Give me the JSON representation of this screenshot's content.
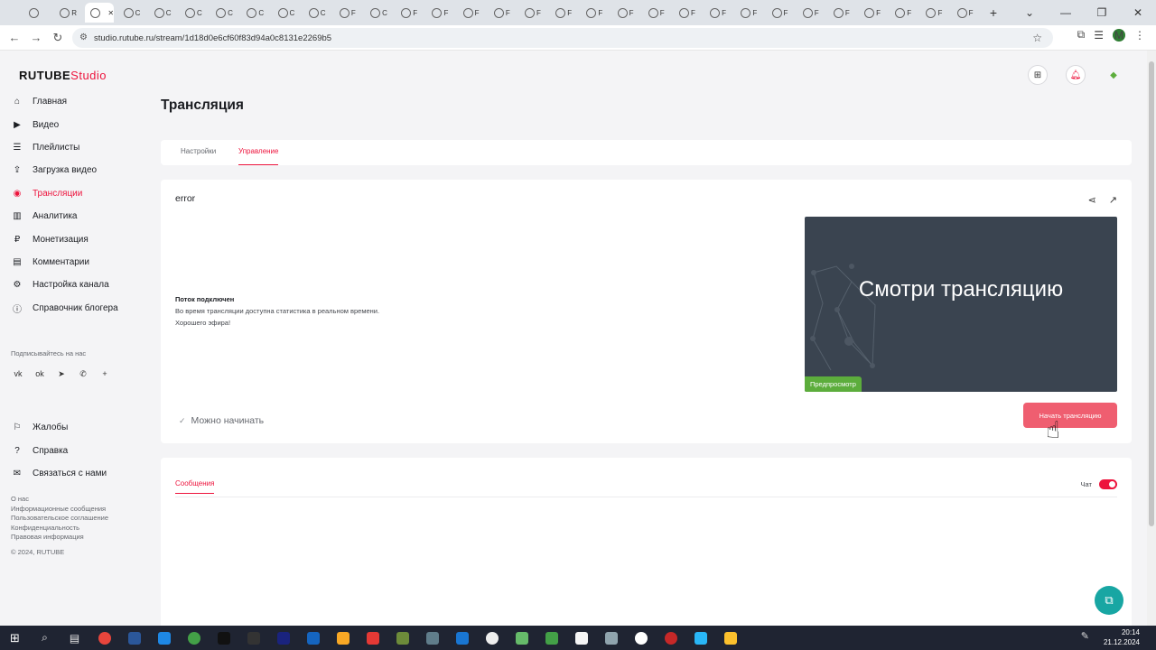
{
  "browser": {
    "url": "studio.rutube.ru/stream/1d18d0e6cf60f83d94a0c8131e2269b5",
    "tabs": [
      {
        "label": "",
        "icon": "chrome-icon"
      },
      {
        "label": "R",
        "icon": "rutube-icon"
      },
      {
        "label": "",
        "icon": "rutube-studio-icon",
        "active": true
      },
      {
        "label": "C",
        "icon": "openai-icon"
      },
      {
        "label": "C",
        "icon": "openai-icon"
      },
      {
        "label": "C",
        "icon": "web-icon"
      },
      {
        "label": "C",
        "icon": "web-icon"
      },
      {
        "label": "C",
        "icon": "web-icon"
      },
      {
        "label": "C",
        "icon": "web-icon"
      },
      {
        "label": "C",
        "icon": "web-icon"
      },
      {
        "label": "F",
        "icon": "web-icon"
      },
      {
        "label": "C",
        "icon": "web-icon"
      },
      {
        "label": "F",
        "icon": "web-icon"
      },
      {
        "label": "F",
        "icon": "web-icon"
      },
      {
        "label": "F",
        "icon": "web-icon"
      },
      {
        "label": "F",
        "icon": "web-icon"
      },
      {
        "label": "F",
        "icon": "web-icon"
      },
      {
        "label": "F",
        "icon": "web-icon"
      },
      {
        "label": "F",
        "icon": "web-icon"
      },
      {
        "label": "F",
        "icon": "web-icon"
      },
      {
        "label": "F",
        "icon": "web-icon"
      },
      {
        "label": "F",
        "icon": "web-icon"
      },
      {
        "label": "F",
        "icon": "web-icon"
      },
      {
        "label": "F",
        "icon": "web-icon"
      },
      {
        "label": "F",
        "icon": "web-icon"
      },
      {
        "label": "F",
        "icon": "web-icon"
      },
      {
        "label": "F",
        "icon": "web-icon"
      },
      {
        "label": "F",
        "icon": "web-icon"
      },
      {
        "label": "F",
        "icon": "web-icon"
      },
      {
        "label": "F",
        "icon": "web-icon"
      },
      {
        "label": "F",
        "icon": "web-icon"
      }
    ],
    "profile_initial": "M"
  },
  "app": {
    "logo_main": "RUTUBE",
    "logo_sub": "Studio",
    "accent": "#ed143d"
  },
  "sidebar": {
    "items": [
      {
        "label": "Главная",
        "icon": "home-icon"
      },
      {
        "label": "Видео",
        "icon": "video-icon"
      },
      {
        "label": "Плейлисты",
        "icon": "playlist-icon"
      },
      {
        "label": "Загрузка видео",
        "icon": "upload-icon"
      },
      {
        "label": "Трансляции",
        "icon": "broadcast-icon",
        "active": true
      },
      {
        "label": "Аналитика",
        "icon": "analytics-icon"
      },
      {
        "label": "Монетизация",
        "icon": "monetization-icon"
      },
      {
        "label": "Комментарии",
        "icon": "comments-icon"
      },
      {
        "label": "Настройка канала",
        "icon": "settings-icon"
      },
      {
        "label": "Справочник блогера",
        "icon": "info-icon"
      }
    ],
    "follow_label": "Подписывайтесь на нас",
    "socials": [
      "vk-icon",
      "ok-icon",
      "telegram-icon",
      "viber-icon",
      "more-icon"
    ],
    "secondary": [
      {
        "label": "Жалобы",
        "icon": "flag-icon"
      },
      {
        "label": "Справка",
        "icon": "help-icon"
      },
      {
        "label": "Связаться с нами",
        "icon": "mail-icon"
      }
    ],
    "footer_links": [
      "О нас",
      "Информационные сообщения",
      "Пользовательское соглашение",
      "Конфиденциальность",
      "Правовая информация"
    ],
    "copyright": "© 2024, RUTUBE"
  },
  "main": {
    "title": "Трансляция",
    "tabs": [
      {
        "label": "Настройки"
      },
      {
        "label": "Управление",
        "active": true
      }
    ],
    "stream": {
      "name": "error",
      "status_title": "Поток подключен",
      "status_line1": "Во время трансляции доступна статистика в реальном времени.",
      "status_line2": "Хорошего эфира!",
      "ready_label": "Можно начинать",
      "preview_text": "Смотри трансляцию",
      "preview_badge": "Предпросмотр",
      "start_button": "Начать трансляцию"
    },
    "messages": {
      "tab_label": "Сообщения",
      "chat_label": "Чат",
      "chat_enabled": true
    }
  },
  "taskbar": {
    "time": "20:14",
    "date": "21.12.2024"
  }
}
